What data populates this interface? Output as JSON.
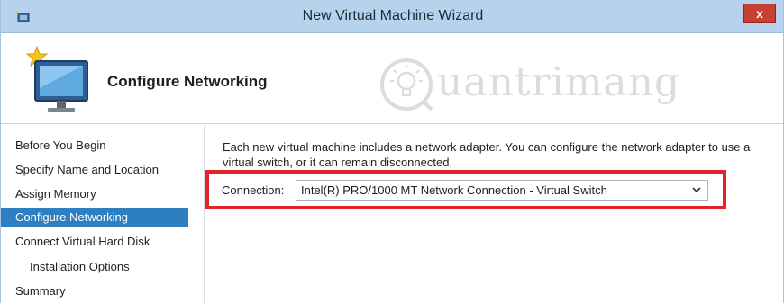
{
  "window": {
    "title": "New Virtual Machine Wizard",
    "close_label": "x"
  },
  "header": {
    "title": "Configure Networking",
    "watermark_text": "uantrimang"
  },
  "nav": {
    "items": [
      {
        "label": "Before You Begin",
        "active": false,
        "indent": false
      },
      {
        "label": "Specify Name and Location",
        "active": false,
        "indent": false
      },
      {
        "label": "Assign Memory",
        "active": false,
        "indent": false
      },
      {
        "label": "Configure Networking",
        "active": true,
        "indent": false
      },
      {
        "label": "Connect Virtual Hard Disk",
        "active": false,
        "indent": false
      },
      {
        "label": "Installation Options",
        "active": false,
        "indent": true
      },
      {
        "label": "Summary",
        "active": false,
        "indent": false
      }
    ]
  },
  "content": {
    "description": "Each new virtual machine includes a network adapter. You can configure the network adapter to use a virtual switch, or it can remain disconnected.",
    "connection_label": "Connection:",
    "connection_value": "Intel(R) PRO/1000 MT Network Connection - Virtual Switch"
  },
  "colors": {
    "titlebar": "#b6d2ec",
    "nav_active": "#2d7fc1",
    "highlight_border": "#e3232c",
    "close_button": "#c84031"
  },
  "icons": {
    "app": "hyperv-app-icon",
    "header": "new-vm-monitor-icon",
    "dropdown": "chevron-down-icon",
    "watermark_logo": "lightbulb-logo-icon"
  }
}
